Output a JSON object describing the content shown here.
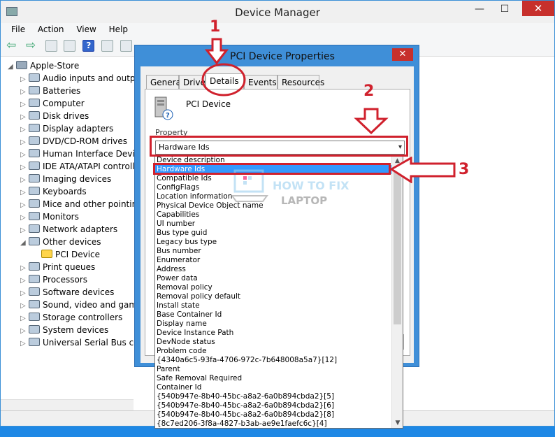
{
  "device_manager": {
    "title": "Device Manager",
    "minimize": "—",
    "maximize": "☐",
    "close": "✕",
    "menu": [
      "File",
      "Action",
      "View",
      "Help"
    ],
    "tree": [
      {
        "label": "Apple-Store",
        "exp": "◢",
        "indent": 0
      },
      {
        "label": "Audio inputs and outputs",
        "exp": "▷",
        "indent": 1
      },
      {
        "label": "Batteries",
        "exp": "▷",
        "indent": 1
      },
      {
        "label": "Computer",
        "exp": "▷",
        "indent": 1
      },
      {
        "label": "Disk drives",
        "exp": "▷",
        "indent": 1
      },
      {
        "label": "Display adapters",
        "exp": "▷",
        "indent": 1
      },
      {
        "label": "DVD/CD-ROM drives",
        "exp": "▷",
        "indent": 1
      },
      {
        "label": "Human Interface Devices",
        "exp": "▷",
        "indent": 1
      },
      {
        "label": "IDE ATA/ATAPI controllers",
        "exp": "▷",
        "indent": 1
      },
      {
        "label": "Imaging devices",
        "exp": "▷",
        "indent": 1
      },
      {
        "label": "Keyboards",
        "exp": "▷",
        "indent": 1
      },
      {
        "label": "Mice and other pointing devices",
        "exp": "▷",
        "indent": 1
      },
      {
        "label": "Monitors",
        "exp": "▷",
        "indent": 1
      },
      {
        "label": "Network adapters",
        "exp": "▷",
        "indent": 1
      },
      {
        "label": "Other devices",
        "exp": "◢",
        "indent": 1
      },
      {
        "label": "PCI Device",
        "exp": "",
        "indent": 2
      },
      {
        "label": "Print queues",
        "exp": "▷",
        "indent": 1
      },
      {
        "label": "Processors",
        "exp": "▷",
        "indent": 1
      },
      {
        "label": "Software devices",
        "exp": "▷",
        "indent": 1
      },
      {
        "label": "Sound, video and game controllers",
        "exp": "▷",
        "indent": 1
      },
      {
        "label": "Storage controllers",
        "exp": "▷",
        "indent": 1
      },
      {
        "label": "System devices",
        "exp": "▷",
        "indent": 1
      },
      {
        "label": "Universal Serial Bus controllers",
        "exp": "▷",
        "indent": 1
      }
    ]
  },
  "dialog": {
    "title": "PCI Device Properties",
    "close": "✕",
    "tabs": [
      "General",
      "Driver",
      "Details",
      "Events",
      "Resources"
    ],
    "active_tab": "Details",
    "device_name": "PCI Device",
    "property_label": "Property",
    "property_selected": "Hardware Ids",
    "options": [
      "Device description",
      "Hardware Ids",
      "Compatible Ids",
      "ConfigFlags",
      "Location information",
      "Physical Device Object name",
      "Capabilities",
      "UI number",
      "Bus type guid",
      "Legacy bus type",
      "Bus number",
      "Enumerator",
      "Address",
      "Power data",
      "Removal policy",
      "Removal policy default",
      "Install state",
      "Base Container Id",
      "Display name",
      "Device Instance Path",
      "DevNode status",
      "Problem code",
      "{4340a6c5-93fa-4706-972c-7b648008a5a7}[12]",
      "Parent",
      "Safe Removal Required",
      "Container Id",
      "{540b947e-8b40-45bc-a8a2-6a0b894cbda2}[5]",
      "{540b947e-8b40-45bc-a8a2-6a0b894cbda2}[6]",
      "{540b947e-8b40-45bc-a8a2-6a0b894cbda2}[8]",
      "{8c7ed206-3f8a-4827-b3ab-ae9e1faefc6c}[4]"
    ],
    "highlighted_option": "Hardware Ids"
  },
  "annotations": {
    "step1": "1",
    "step2": "2",
    "step3": "3",
    "accent": "#d0212d"
  },
  "watermark": {
    "line1": "HOW TO FIX",
    "line2": "LAPTOP"
  }
}
